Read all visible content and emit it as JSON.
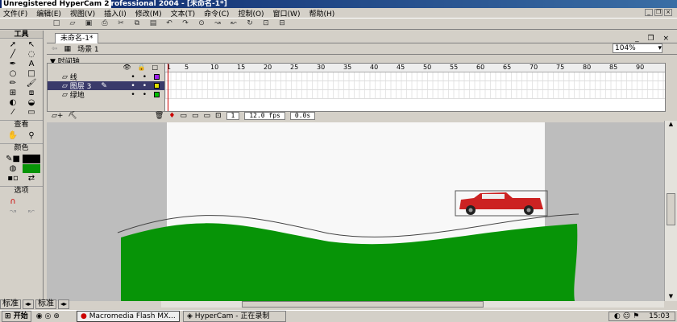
{
  "window": {
    "title_prefix": "Unregistered HyperCam 2",
    "title_rest": "rofessional 2004 - [未命名-1*]"
  },
  "menu": [
    "文件(F)",
    "编辑(E)",
    "视图(V)",
    "插入(I)",
    "修改(M)",
    "文本(T)",
    "命令(C)",
    "控制(O)",
    "窗口(W)",
    "帮助(H)"
  ],
  "toolbar_icons": [
    "new-icon",
    "open-icon",
    "save-icon",
    "print-icon",
    "cut-icon",
    "copy-icon",
    "paste-icon",
    "undo-icon",
    "redo-icon",
    "snap-icon",
    "smooth-icon",
    "straighten-icon",
    "rotate-icon",
    "scale-icon",
    "align-icon"
  ],
  "tools": {
    "header": "工具",
    "view_label": "查看",
    "colors_label": "颜色",
    "options_label": "选项"
  },
  "document": {
    "tab_label": "未命名-1*",
    "scene_label": "场景 1",
    "zoom": "104%"
  },
  "timeline": {
    "label": "时间轴",
    "ruler_numbers": [
      "1",
      "5",
      "10",
      "15",
      "20",
      "25",
      "30",
      "35",
      "40",
      "45",
      "50",
      "55",
      "60",
      "65",
      "70",
      "75",
      "80",
      "85",
      "90"
    ],
    "layers": [
      {
        "name": "线",
        "color": "#a020f0",
        "selected": false
      },
      {
        "name": "图层 3",
        "color": "#e0e000",
        "selected": true
      },
      {
        "name": "绿地",
        "color": "#00c000",
        "selected": false
      }
    ],
    "current_frame": "1",
    "fps": "12.0 fps",
    "time": "0.0s"
  },
  "bottom_tabs": [
    "标准",
    "标准"
  ],
  "taskbar": {
    "start_label": "开始",
    "tasks": [
      "Macromedia Flash MX...",
      "HyperCam - 正在录制"
    ],
    "clock": "15:03"
  },
  "colors": {
    "ground": "#079407",
    "car": "#cc2222"
  }
}
